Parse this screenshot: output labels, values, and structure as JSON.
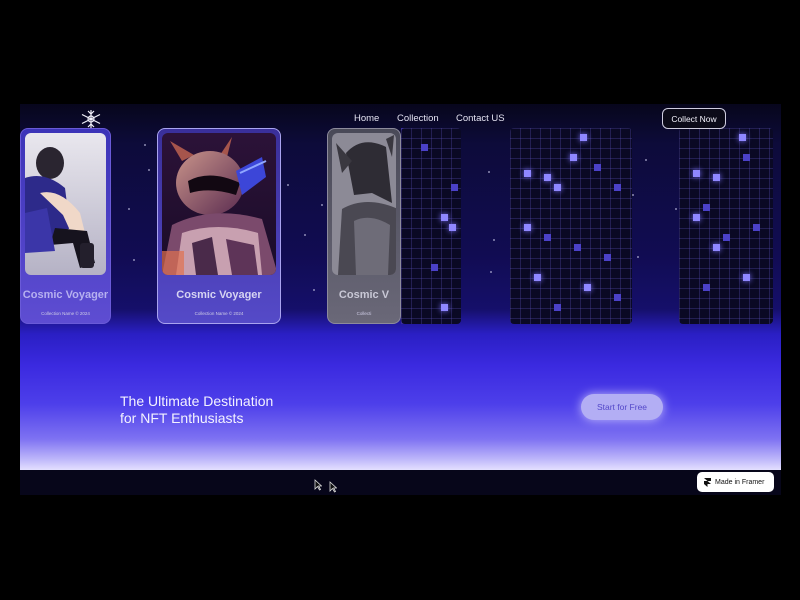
{
  "nav": {
    "links": [
      "Home",
      "Collection",
      "Contact US"
    ],
    "cta_label": "Collect Now"
  },
  "cards": [
    {
      "title": "Cosmic Voyager",
      "subtitle": "Collection Name © 2024"
    },
    {
      "title": "Cosmic Voyager",
      "subtitle": "Collection Name © 2024"
    },
    {
      "title": "Cosmic V",
      "subtitle": "Collecti"
    }
  ],
  "hero": {
    "headline_line1": "The Ultimate Destination",
    "headline_line2": "for NFT Enthusiasts",
    "cta_label": "Start for Free"
  },
  "badge": {
    "label": "Made in Framer"
  },
  "colors": {
    "accent": "#4d3fea",
    "button_light": "#b3aef4",
    "pixel_glow": "#8f87ff"
  }
}
